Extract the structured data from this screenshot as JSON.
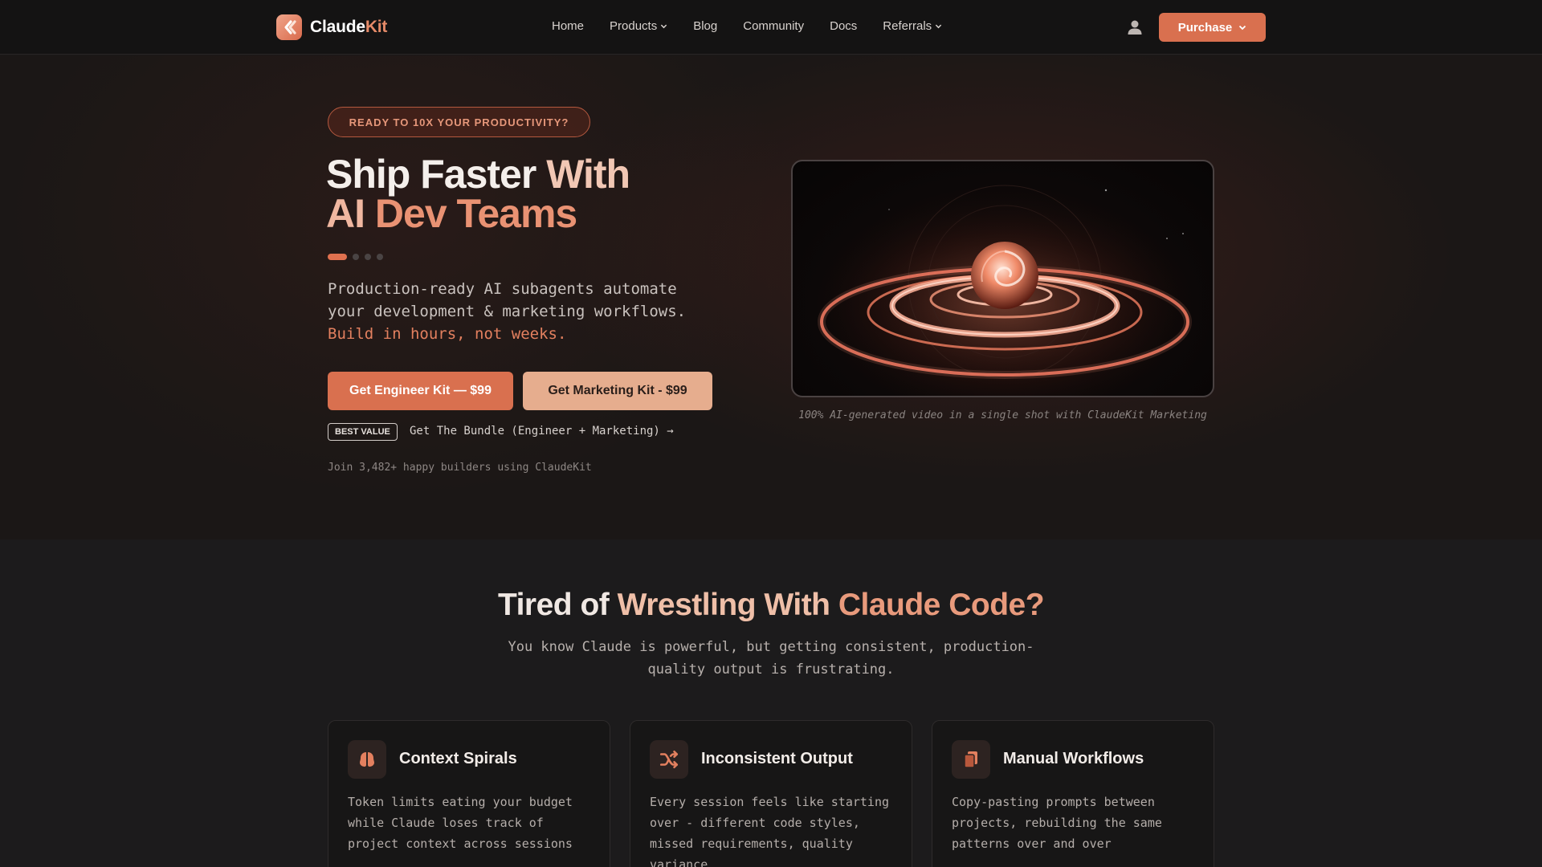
{
  "nav": {
    "logo_main": "Claude",
    "logo_accent": "Kit",
    "links": [
      {
        "label": "Home",
        "dropdown": false
      },
      {
        "label": "Products",
        "dropdown": true
      },
      {
        "label": "Blog",
        "dropdown": false
      },
      {
        "label": "Community",
        "dropdown": false
      },
      {
        "label": "Docs",
        "dropdown": false
      },
      {
        "label": "Referrals",
        "dropdown": true
      }
    ],
    "user_icon": "user-icon",
    "purchase_label": "Purchase"
  },
  "hero": {
    "badge": "READY TO 10X YOUR PRODUCTIVITY?",
    "title_line1_a": "Ship Faster ",
    "title_line1_b": "With",
    "title_line2_a": "AI ",
    "title_line2_b": "Dev Teams",
    "carousel_dots": 4,
    "carousel_active": 0,
    "description": "Production-ready AI subagents automate your development & marketing workflows. ",
    "description_highlight": "Build in hours, not weeks.",
    "cta_engineer": "Get Engineer Kit — $99",
    "cta_marketing": "Get Marketing Kit - $99",
    "best_value_badge": "BEST VALUE",
    "bundle_link": "Get The Bundle (Engineer + Marketing) →",
    "social_proof": "Join 3,482+ happy builders using ClaudeKit",
    "video_caption": "100% AI-generated video in a single shot with ClaudeKit Marketing"
  },
  "problem": {
    "title_a": "Tired of ",
    "title_b": "Wrestling With ",
    "title_c": "Claude Code?",
    "subtitle": "You know Claude is powerful, but getting consistent, production-quality output is frustrating.",
    "cards": [
      {
        "icon": "brain-icon",
        "title": "Context Spirals",
        "desc": "Token limits eating your budget while Claude loses track of project context across sessions"
      },
      {
        "icon": "shuffle-icon",
        "title": "Inconsistent Output",
        "desc": "Every session feels like starting over - different code styles, missed requirements, quality variance"
      },
      {
        "icon": "copy-icon",
        "title": "Manual Workflows",
        "desc": "Copy-pasting prompts between projects, rebuilding the same patterns over and over"
      }
    ]
  },
  "colors": {
    "accent": "#d9704f",
    "accent_light": "#e6ad8e",
    "background": "#1a1818"
  }
}
